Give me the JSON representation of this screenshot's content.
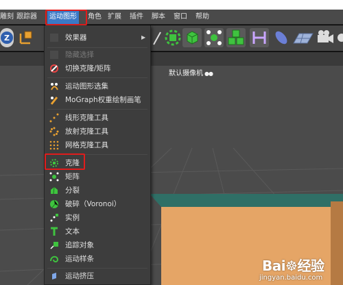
{
  "menubar": {
    "items": [
      "雕刻",
      "跟踪器",
      "运动图形",
      "角色",
      "扩展",
      "插件",
      "脚本",
      "窗口",
      "帮助"
    ],
    "active": "运动图形"
  },
  "viewport": {
    "camera_label": "默认摄像机",
    "camera_icon": "camera-dots-icon"
  },
  "dropdown": {
    "items": [
      {
        "label": "效果器",
        "icon": "none",
        "submenu": true
      },
      {
        "label": "隐藏选择",
        "icon": "none",
        "disabled": true
      },
      {
        "label": "切换克隆/矩阵",
        "icon": "toggle-clone-matrix-icon"
      },
      {
        "label": "运动图形选集",
        "icon": "mograph-selection-icon"
      },
      {
        "label": "MoGraph权重绘制画笔",
        "icon": "weight-paint-brush-icon"
      },
      {
        "label": "线形克隆工具",
        "icon": "linear-clone-tool-icon"
      },
      {
        "label": "放射克隆工具",
        "icon": "radial-clone-tool-icon"
      },
      {
        "label": "网格克隆工具",
        "icon": "grid-clone-tool-icon"
      },
      {
        "label": "克隆",
        "icon": "cloner-icon"
      },
      {
        "label": "矩阵",
        "icon": "matrix-icon"
      },
      {
        "label": "分裂",
        "icon": "fracture-icon"
      },
      {
        "label": "破碎（Voronoi）",
        "icon": "voronoi-fracture-icon"
      },
      {
        "label": "实例",
        "icon": "instance-icon"
      },
      {
        "label": "文本",
        "icon": "text-icon"
      },
      {
        "label": "追踪对象",
        "icon": "tracer-icon"
      },
      {
        "label": "运动样条",
        "icon": "mospline-icon"
      },
      {
        "label": "运动挤压",
        "icon": "moextrude-icon"
      }
    ]
  },
  "watermark": {
    "logo_a": "Bai",
    "logo_b": "经验",
    "site": "jingyan.baidu.com"
  },
  "colors": {
    "menu_active": "#3b79c6",
    "highlight_box": "#e11c1c",
    "icon_green": "#3fc33f",
    "cube_top": "#2f6f66",
    "cube_front": "#e5a566"
  }
}
